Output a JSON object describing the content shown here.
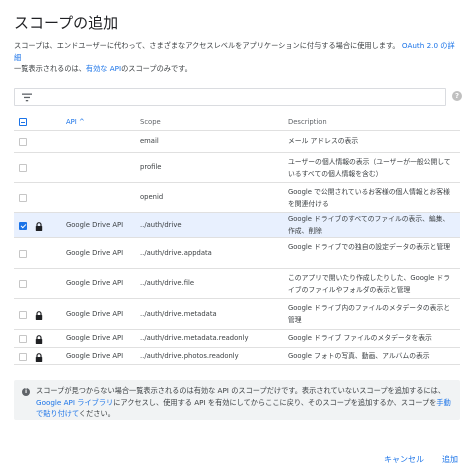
{
  "dialog": {
    "title": "スコープの追加",
    "description_line1": "スコープは、エンドユーザーに代わって、さまざまなアクセスレベルをアプリケーションに付与する場合に使用します。",
    "oauth_link": "OAuth 2.0 の詳細",
    "description_line2_pre": "一覧表示されるのは、",
    "enabled_api_link": "有効な API",
    "description_line2_post": "のスコープのみです。",
    "filter": {
      "placeholder": ""
    },
    "help_icon": "?"
  },
  "table": {
    "columns": {
      "api": "API",
      "scope": "Scope",
      "description": "Description"
    },
    "rows": [
      {
        "api": "",
        "scope": "email",
        "description": "メール アドレスの表示",
        "checked": false,
        "locked": false
      },
      {
        "api": "",
        "scope": "profile",
        "description": "ユーザーの個人情報の表示（ユーザーが一般公開しているすべての個人情報を含む）",
        "checked": false,
        "locked": false
      },
      {
        "api": "",
        "scope": "openid",
        "description": "Google で公開されているお客様の個人情報とお客様を関連付ける",
        "checked": false,
        "locked": false
      },
      {
        "api": "Google Drive API",
        "scope": "../auth/drive",
        "description": "Google ドライブのすべてのファイルの表示、編集、作成、削除",
        "checked": true,
        "locked": true
      },
      {
        "api": "Google Drive API",
        "scope": "../auth/drive.appdata",
        "description": "Google ドライブでの独自の設定データの表示と管理",
        "checked": false,
        "locked": false
      },
      {
        "api": "Google Drive API",
        "scope": "../auth/drive.file",
        "description": "このアプリで開いたり作成したりした、Google ドライブのファイルやフォルダの表示と管理",
        "checked": false,
        "locked": false
      },
      {
        "api": "Google Drive API",
        "scope": "../auth/drive.metadata",
        "description": "Google ドライブ内のファイルのメタデータの表示と管理",
        "checked": false,
        "locked": true
      },
      {
        "api": "Google Drive API",
        "scope": "../auth/drive.metadata.readonly",
        "description": "Google ドライブ ファイルのメタデータを表示",
        "checked": false,
        "locked": true
      },
      {
        "api": "Google Drive API",
        "scope": "../auth/drive.photos.readonly",
        "description": "Google フォトの写真、動画、アルバムの表示",
        "checked": false,
        "locked": true
      }
    ]
  },
  "info": {
    "icon": "i",
    "text1": "スコープが見つからない場合一覧表示されるのは有効な API のスコープだけです。表示されていないスコープを追加するには、",
    "link1": "Google API ライブラリ",
    "text2": "にアクセスし、使用する API を有効にしてからここに戻り、そのスコープを追加するか、スコープを",
    "link2": "手動で貼り付けて",
    "text3": "ください。"
  },
  "buttons": {
    "cancel": "キャンセル",
    "add": "追加"
  },
  "colors": {
    "accent": "#1a73e8",
    "selected_row": "#e8f0fe"
  }
}
